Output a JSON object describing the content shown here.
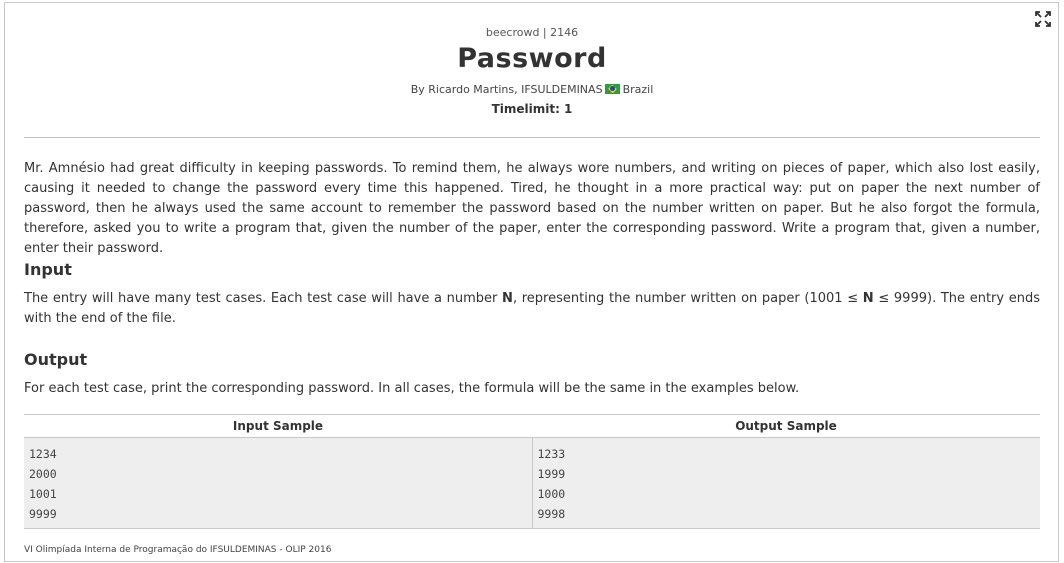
{
  "header": {
    "source": "beecrowd | 2146",
    "title": "Password",
    "author_prefix": "By Ricardo Martins, IFSULDEMINAS",
    "country": "Brazil",
    "timelimit": "Timelimit: 1"
  },
  "description": "Mr. Amnésio had great difficulty in keeping passwords. To remind them, he always wore numbers, and writing on pieces of paper, which also lost easily, causing it needed to change the password every time this happened. Tired, he thought in a more practical way: put on paper the next number of password, then he always used the same account to remember the password based on the number written on paper. But he also forgot the formula, therefore, asked you to write a program that, given the number of the paper, enter the corresponding password. Write a program that, given a number, enter their password.",
  "input": {
    "heading": "Input",
    "text_before_n": "The entry will have many test cases. Each test case will have a number ",
    "n": "N",
    "text_mid": ", representing the number written on paper (1001 ≤ ",
    "n2": "N",
    "text_after": " ≤ 9999). The entry ends with the end of the file."
  },
  "output": {
    "heading": "Output",
    "text": "For each test case, print the corresponding password. In all cases, the formula will be the same in the examples below."
  },
  "samples": {
    "input_header": "Input Sample",
    "output_header": "Output Sample",
    "input_lines": [
      "1234",
      "2000",
      "1001",
      "9999"
    ],
    "output_lines": [
      "1233",
      "1999",
      "1000",
      "9998"
    ]
  },
  "footer": "VI Olimpíada Interna de Programação do IFSULDEMINAS - OLIP 2016",
  "icons": {
    "expand": "fullscreen-icon",
    "flag": "brazil-flag-icon"
  }
}
